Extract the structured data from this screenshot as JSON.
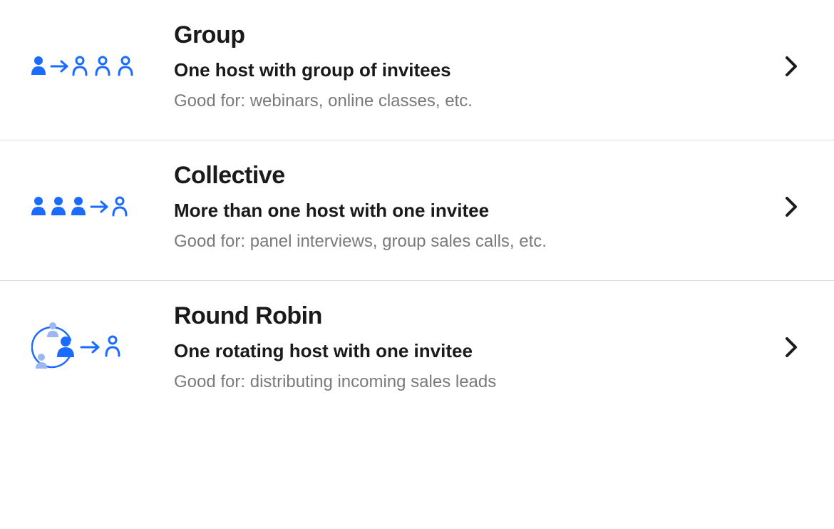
{
  "colors": {
    "primary": "#1a6bff",
    "primary_light": "#9cb8f2",
    "text": "#1a1a1a",
    "muted": "#7a7a7a",
    "border": "#d9d9d9"
  },
  "options": [
    {
      "icon": "group-icon",
      "title": "Group",
      "subtitle": "One host with group of invitees",
      "desc": "Good for: webinars, online classes, etc."
    },
    {
      "icon": "collective-icon",
      "title": "Collective",
      "subtitle": "More than one host with one invitee",
      "desc": "Good for: panel interviews, group sales calls, etc."
    },
    {
      "icon": "round-robin-icon",
      "title": "Round Robin",
      "subtitle": "One rotating host with one invitee",
      "desc": "Good for: distributing incoming sales leads"
    }
  ]
}
